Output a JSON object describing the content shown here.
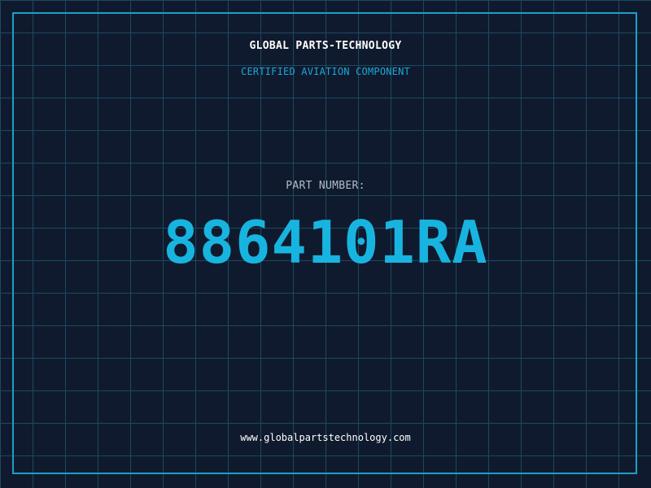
{
  "header": {
    "company": "GLOBAL PARTS-TECHNOLOGY",
    "subtitle": "CERTIFIED AVIATION COMPONENT"
  },
  "part": {
    "label": "PART NUMBER:",
    "number": "8864101RA"
  },
  "footer": {
    "website": "www.globalpartstechnology.com"
  },
  "colors": {
    "background": "#101a2e",
    "grid": "#1b4a5e",
    "accent": "#1aa8d8",
    "frame": "#1aa0c8"
  }
}
